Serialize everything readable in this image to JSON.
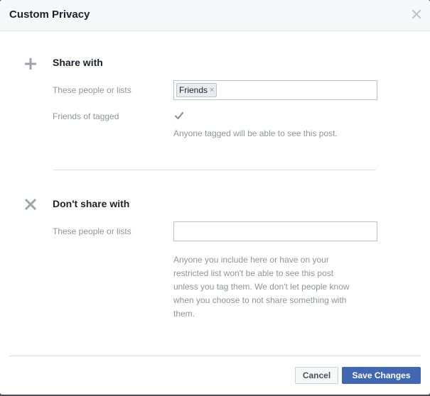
{
  "dialog": {
    "title": "Custom Privacy",
    "close_icon": "close-icon"
  },
  "share_with": {
    "icon": "plus-icon",
    "title": "Share with",
    "people_label": "These people or lists",
    "tokens": [
      {
        "label": "Friends",
        "remove_glyph": "×"
      }
    ],
    "tagged_label": "Friends of tagged",
    "tagged_checked": true,
    "tagged_help": "Anyone tagged will be able to see this post."
  },
  "dont_share_with": {
    "icon": "x-icon",
    "title": "Don't share with",
    "people_label": "These people or lists",
    "input_value": "",
    "help_lines": [
      "Anyone you include here or have on your",
      "restricted list won't be able to see this post",
      "unless you tag them. We don't let people know",
      "when you choose to not share something with",
      "them."
    ]
  },
  "footer": {
    "cancel_label": "Cancel",
    "save_label": "Save Changes"
  },
  "colors": {
    "primary_button": "#4267b2",
    "header_bg": "#f6f7f9",
    "muted_text": "#90949c"
  }
}
